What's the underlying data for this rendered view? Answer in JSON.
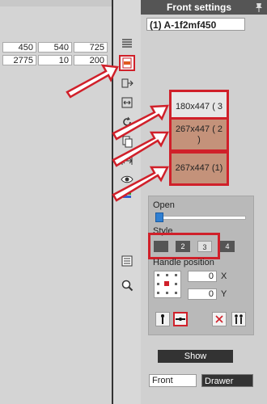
{
  "panel": {
    "title": "Front settings",
    "id_value": "(1) A-1f2mf450"
  },
  "table": {
    "rows": [
      [
        "450",
        "540",
        "725"
      ],
      [
        "2775",
        "10",
        "200"
      ]
    ]
  },
  "toolbar": {
    "icons": [
      "list-lines-icon",
      "front-panel-icon",
      "move-right-icon",
      "width-arrows-icon",
      "rotate-icon",
      "copy-icon",
      "stretch-icon",
      "eye-icon",
      "color-bars-icon",
      "lines-icon",
      "zoom-icon"
    ]
  },
  "sizes": [
    {
      "label": "180x447 ( 3"
    },
    {
      "label": "267x447 ( 2 )"
    },
    {
      "label": "267x447 (1)"
    }
  ],
  "options": {
    "open_label": "Open",
    "open_value": 0.0,
    "style_label": "Style",
    "style_buttons": [
      "",
      "2",
      "3",
      "4"
    ],
    "style_selected": "3",
    "handle_label": "Handle position",
    "x_label": "X",
    "y_label": "Y",
    "x_value": "0",
    "y_value": "0"
  },
  "buttons": {
    "show": "Show",
    "front_field": "Front",
    "drawer": "Drawer"
  },
  "colors": {
    "highlight": "#d0202a",
    "brown_box": "#c4927a",
    "header": "#555555",
    "slider": "#2f7fd2"
  }
}
